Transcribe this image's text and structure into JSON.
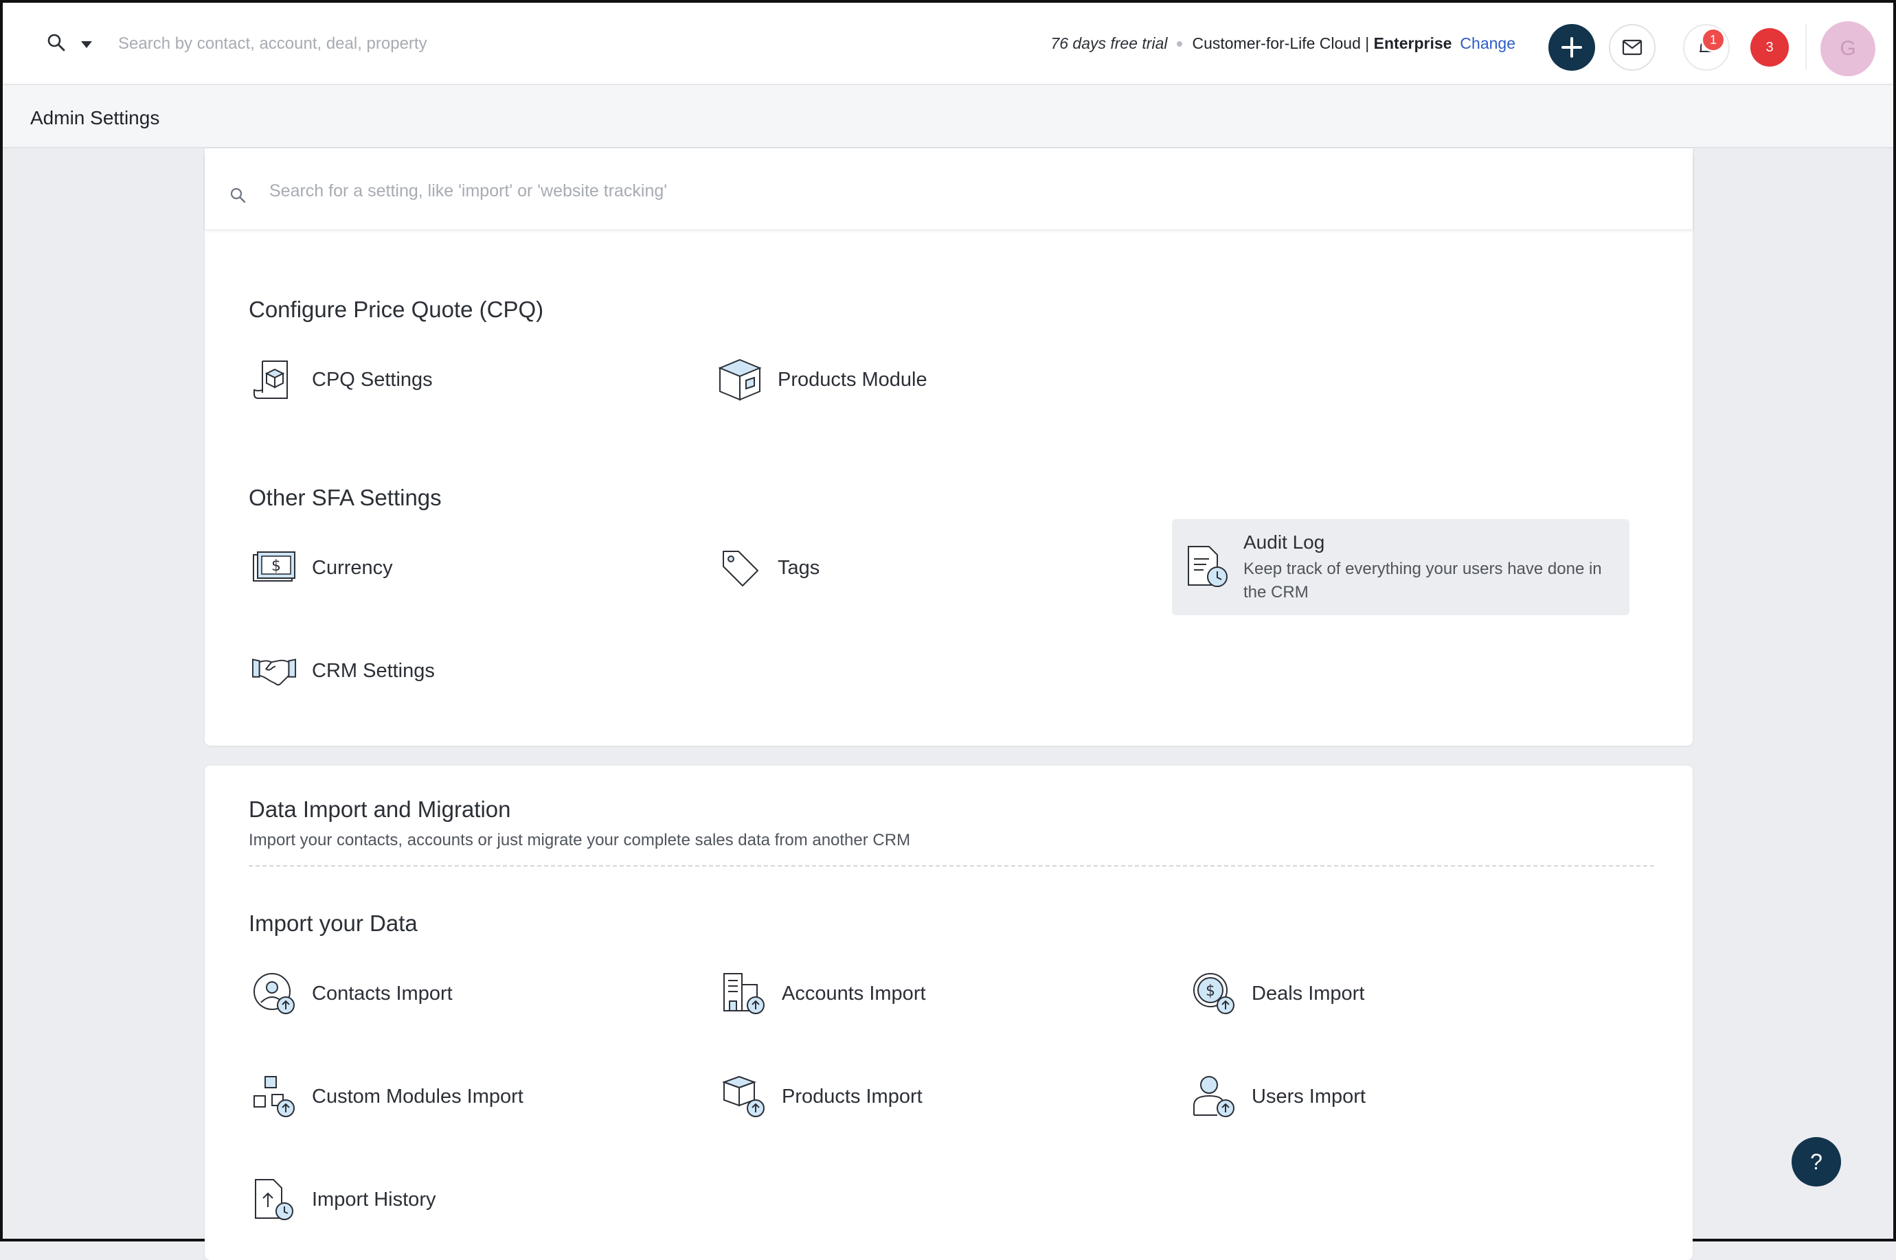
{
  "topbar": {
    "search_placeholder": "Search by contact, account, deal, property",
    "trial_days": "76 days free trial",
    "plan_name": "Customer-for-Life Cloud | ",
    "plan_tier": "Enterprise",
    "change_label": "Change",
    "notification_count": "1",
    "alerts_count": "3",
    "avatar_initial": "G"
  },
  "header": {
    "title": "Admin Settings"
  },
  "settings_search": {
    "placeholder": "Search for a setting, like 'import' or 'website tracking'"
  },
  "cpq": {
    "title": "Configure Price Quote (CPQ)",
    "items": [
      {
        "label": "CPQ Settings",
        "icon": "document-box-icon"
      },
      {
        "label": "Products Module",
        "icon": "box-icon"
      }
    ]
  },
  "other_sfa": {
    "title": "Other SFA Settings",
    "items": [
      {
        "label": "Currency",
        "icon": "currency-icon"
      },
      {
        "label": "Tags",
        "icon": "tag-icon"
      },
      {
        "label": "CRM Settings",
        "icon": "handshake-icon"
      }
    ],
    "audit_log": {
      "label": "Audit Log",
      "description": "Keep track of everything your users have done in the CRM",
      "icon": "audit-log-icon"
    }
  },
  "data_import": {
    "title": "Data Import and Migration",
    "subtitle": "Import your contacts, accounts or just migrate your complete sales data from another CRM",
    "import_title": "Import your Data",
    "items": [
      {
        "label": "Contacts Import",
        "icon": "contact-import-icon"
      },
      {
        "label": "Accounts Import",
        "icon": "account-import-icon"
      },
      {
        "label": "Deals Import",
        "icon": "deal-import-icon"
      },
      {
        "label": "Custom Modules Import",
        "icon": "custom-module-import-icon"
      },
      {
        "label": "Products Import",
        "icon": "product-import-icon"
      },
      {
        "label": "Users Import",
        "icon": "user-import-icon"
      },
      {
        "label": "Import History",
        "icon": "import-history-icon"
      }
    ]
  },
  "help": {
    "label": "?"
  },
  "colors": {
    "navy": "#12344d",
    "accent_blue": "#2c5cc5",
    "badge_red": "#e43538",
    "icon_fill": "#cfe6f7"
  }
}
